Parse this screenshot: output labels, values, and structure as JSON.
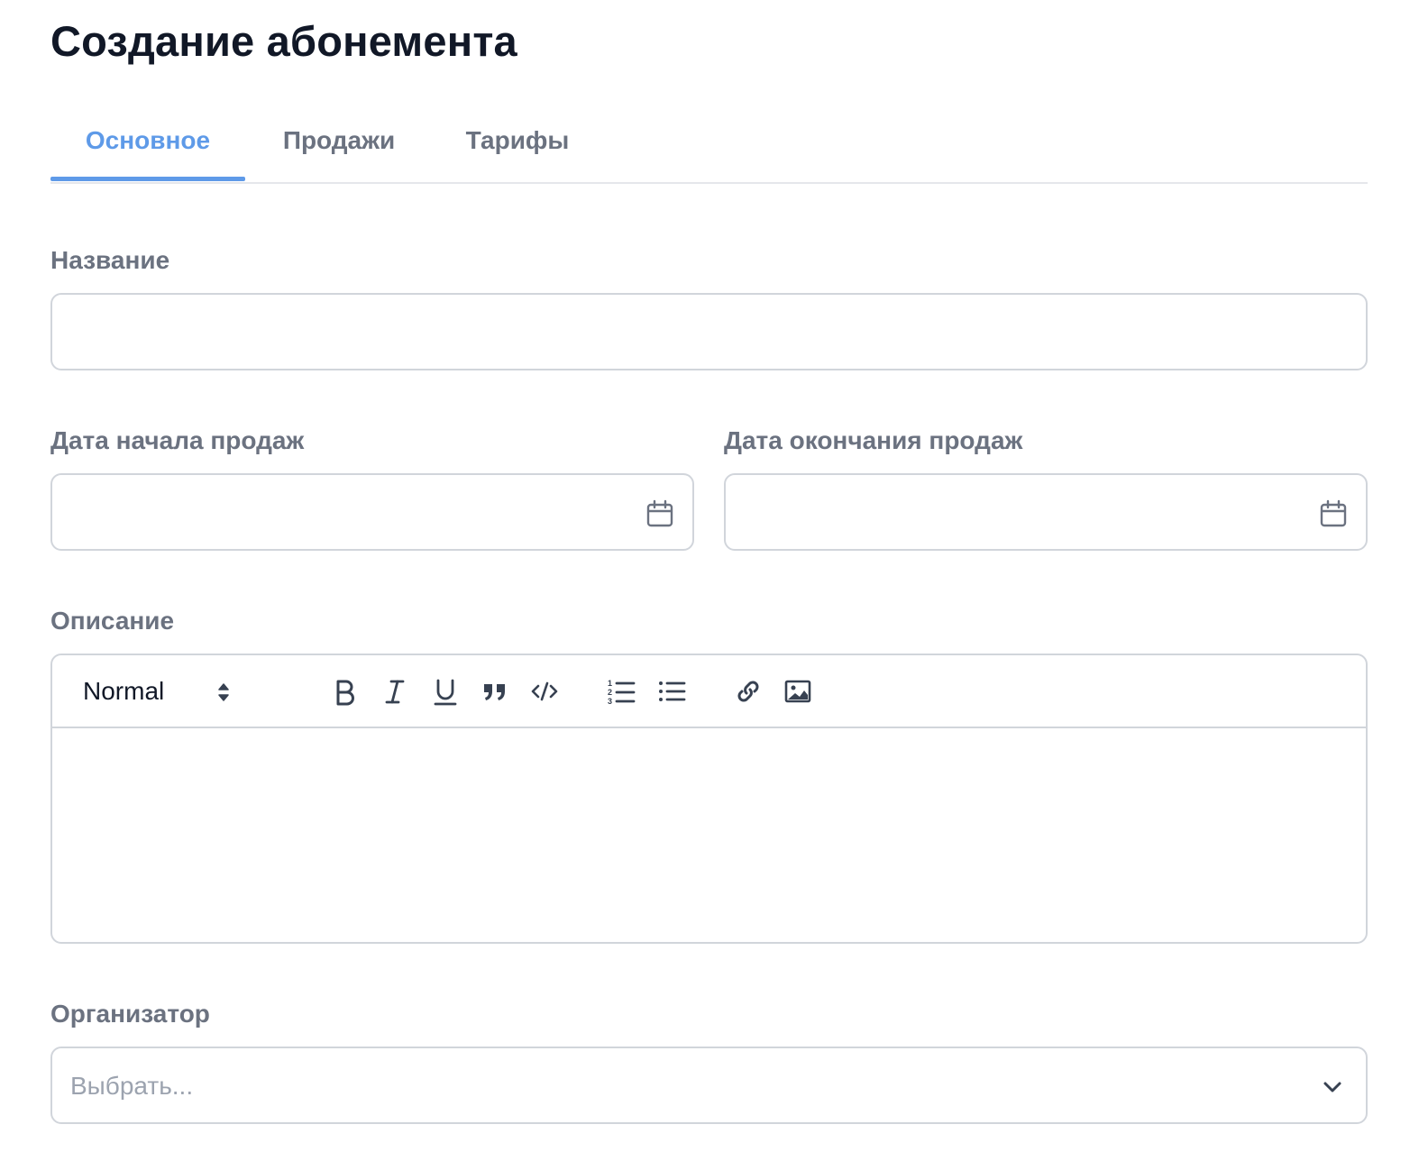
{
  "page": {
    "title": "Создание абонемента"
  },
  "tabs": [
    {
      "label": "Основное",
      "active": true
    },
    {
      "label": "Продажи",
      "active": false
    },
    {
      "label": "Тарифы",
      "active": false
    }
  ],
  "form": {
    "name": {
      "label": "Название",
      "value": "",
      "placeholder": ""
    },
    "sale_start": {
      "label": "Дата начала продаж",
      "value": "",
      "icon": "calendar-icon"
    },
    "sale_end": {
      "label": "Дата окончания продаж",
      "value": "",
      "icon": "calendar-icon"
    },
    "description": {
      "label": "Описание",
      "toolbar": {
        "format_value": "Normal",
        "buttons": [
          "bold-icon",
          "italic-icon",
          "underline-icon",
          "blockquote-icon",
          "code-icon",
          "ordered-list-icon",
          "bullet-list-icon",
          "link-icon",
          "image-icon"
        ]
      },
      "value": ""
    },
    "organizer": {
      "label": "Организатор",
      "placeholder": "Выбрать...",
      "icon": "chevron-down-icon"
    }
  },
  "colors": {
    "accent": "#5e9ae8",
    "label": "#6b7280",
    "border": "#d1d5db",
    "title": "#111827",
    "placeholder": "#9ca3af"
  }
}
